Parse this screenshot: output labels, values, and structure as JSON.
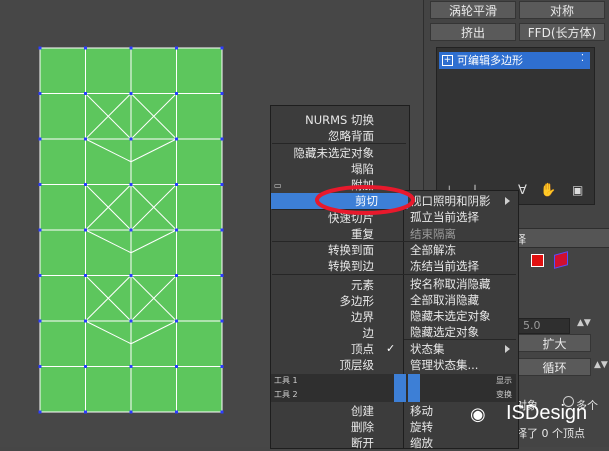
{
  "panel": {
    "buttons": [
      "涡轮平滑",
      "对称",
      "挤出",
      "FFD(长方体)"
    ],
    "stack_item": "可编辑多边形",
    "select_label": "择",
    "spinner_value": "5.0",
    "expand_label": "扩大",
    "loop_label": "循环",
    "object_label": "对象",
    "count_label": "多个",
    "status_line": "择了 0 个顶点"
  },
  "menu": {
    "left_top": [
      "NURMS 切换",
      "忽略背面",
      "隐藏未选定对象",
      "塌陷",
      "附加"
    ],
    "highlighted": "剪切",
    "left_mid": [
      "快速切片",
      "重复",
      "转换到面",
      "转换到边",
      "元素",
      "多边形",
      "边界",
      "边",
      "顶点",
      "顶层级"
    ],
    "right_top": [
      "视口照明和阴影",
      "孤立当前选择",
      "结束隔离",
      "全部解冻",
      "冻结当前选择",
      "按名称取消隐藏",
      "全部取消隐藏",
      "隐藏未选定对象",
      "隐藏选定对象",
      "状态集",
      "管理状态集..."
    ],
    "toolbar1_left": "工具 1",
    "toolbar1_right": "显示",
    "toolbar2_left": "工具 2",
    "toolbar2_right": "变换",
    "left_bottom": [
      "创建",
      "删除",
      "断开"
    ],
    "right_bottom": [
      "移动",
      "旋转",
      "缩放"
    ]
  },
  "watermark": "ISDesign",
  "colors": {
    "mesh_fill": "#5dc65d",
    "mesh_line": "#ffffff",
    "vertex": "#2b3cff",
    "highlight": "#3d7fd6",
    "red_circle": "#e8192c"
  }
}
